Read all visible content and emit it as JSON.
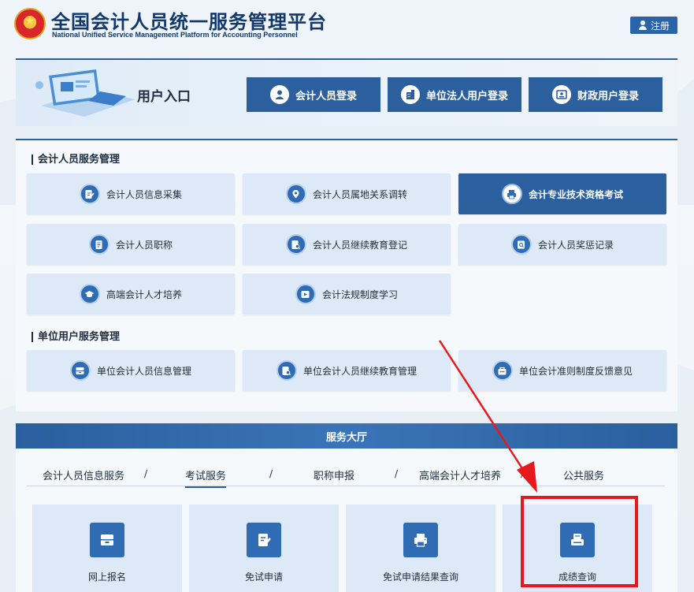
{
  "header": {
    "title": "全国会计人员统一服务管理平台",
    "subtitle": "National Unified Service Management Platform for Accounting Personnel",
    "register_label": "注册"
  },
  "login": {
    "label": "用户入口",
    "buttons": [
      {
        "label": "会计人员登录",
        "icon": "person-icon"
      },
      {
        "label": "单位法人用户登录",
        "icon": "building-icon"
      },
      {
        "label": "财政用户登录",
        "icon": "id-card-icon"
      }
    ]
  },
  "accountant_services": {
    "title": "会计人员服务管理",
    "items": [
      {
        "label": "会计人员信息采集",
        "icon": "edit-form-icon"
      },
      {
        "label": "会计人员属地关系调转",
        "icon": "location-icon"
      },
      {
        "label": "会计专业技术资格考试",
        "icon": "printer-icon",
        "active": true
      },
      {
        "label": "会计人员职称",
        "icon": "document-icon"
      },
      {
        "label": "会计人员继续教育登记",
        "icon": "doc-search-icon"
      },
      {
        "label": "会计人员奖惩记录",
        "icon": "record-search-icon"
      },
      {
        "label": "高端会计人才培养",
        "icon": "graduation-cap-icon"
      },
      {
        "label": "会计法规制度学习",
        "icon": "play-icon"
      }
    ]
  },
  "unit_services": {
    "title": "单位用户服务管理",
    "items": [
      {
        "label": "单位会计人员信息管理",
        "icon": "drawer-icon"
      },
      {
        "label": "单位会计人员继续教育管理",
        "icon": "doc-search-icon"
      },
      {
        "label": "单位会计准则制度反馈意见",
        "icon": "feedback-icon"
      }
    ]
  },
  "hall": {
    "title": "服务大厅",
    "tabs": [
      "会计人员信息服务",
      "考试服务",
      "职称申报",
      "高端会计人才培养",
      "公共服务"
    ],
    "separator": "/",
    "active_tab": "考试服务",
    "cards": [
      {
        "label": "网上报名",
        "icon": "drawer-icon"
      },
      {
        "label": "免试申请",
        "icon": "edit-form-icon"
      },
      {
        "label": "免试申请结果查询",
        "icon": "printer-icon"
      },
      {
        "label": "成绩查询",
        "icon": "printer-icon"
      }
    ]
  },
  "colors": {
    "primary": "#2b5f9e",
    "tile_bg": "#dde9f6",
    "icon_blue": "#2f6cb3",
    "annotation_red": "#e8191c"
  }
}
